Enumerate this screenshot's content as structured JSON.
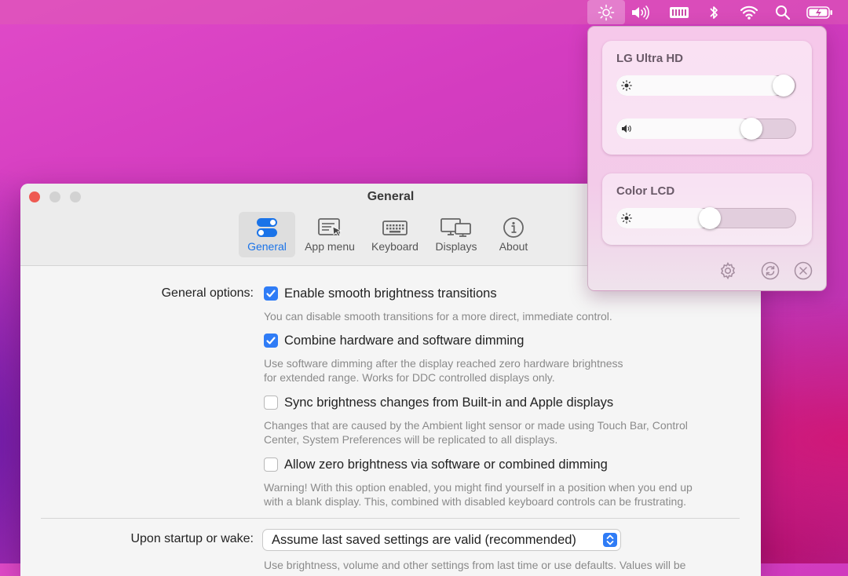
{
  "menubar": {
    "icons": [
      "brightness-icon",
      "volume-icon",
      "keyboard-icon",
      "bluetooth-icon",
      "wifi-icon",
      "search-icon",
      "battery-icon"
    ]
  },
  "popover": {
    "displays": [
      {
        "name": "LG Ultra HD",
        "brightness": 0.93,
        "volume": 0.75
      },
      {
        "name": "Color LCD",
        "brightness": 0.52
      }
    ],
    "footer_icons": [
      "gear-icon",
      "refresh-icon",
      "close-icon"
    ]
  },
  "window": {
    "title": "General",
    "tabs": [
      {
        "label": "General",
        "icon": "toggles-icon",
        "active": true
      },
      {
        "label": "App menu",
        "icon": "menu-cursor-icon",
        "active": false
      },
      {
        "label": "Keyboard",
        "icon": "keyboard-icon",
        "active": false
      },
      {
        "label": "Displays",
        "icon": "displays-icon",
        "active": false
      },
      {
        "label": "About",
        "icon": "info-icon",
        "active": false
      }
    ],
    "general_options_label": "General options:",
    "options": [
      {
        "label": "Enable smooth brightness transitions",
        "checked": true,
        "description": [
          "You can disable smooth transitions for a more direct, immediate control."
        ]
      },
      {
        "label": "Combine hardware and software dimming",
        "checked": true,
        "description": [
          "Use software dimming after the display reached zero hardware brightness",
          "for extended range. Works for DDC controlled displays only."
        ]
      },
      {
        "label": "Sync brightness changes from Built-in and Apple displays",
        "checked": false,
        "description": [
          "Changes that are caused by the Ambient light sensor or made using Touch Bar, Control",
          "Center, System Preferences will be replicated to all displays."
        ]
      },
      {
        "label": "Allow zero brightness via software or combined dimming",
        "checked": false,
        "description": [
          "Warning! With this option enabled, you might find yourself in a position when you end up",
          "with a blank display. This, combined with disabled keyboard controls can be frustrating."
        ]
      }
    ],
    "startup_label": "Upon startup or wake:",
    "startup_value": "Assume last saved settings are valid (recommended)",
    "startup_description": "Use brightness, volume and other settings from last time or use defaults. Values will be"
  },
  "colors": {
    "accent": "#2f7cf6",
    "close": "#ee5a52",
    "inactive_light": "#d2d2d2"
  }
}
